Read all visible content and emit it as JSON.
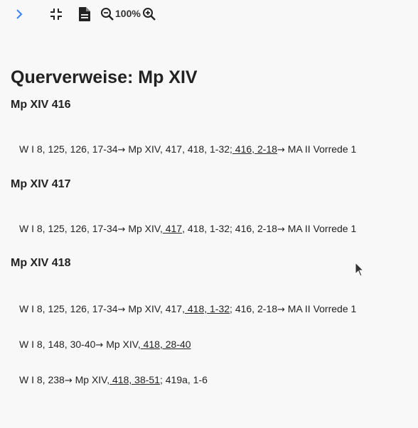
{
  "toolbar": {
    "expand_icon": "chevron-right-icon",
    "compress_icon": "compress-icon",
    "document_icon": "document-icon",
    "zoom_out_icon": "zoom-out-icon",
    "zoom_level": "100%",
    "zoom_in_icon": "zoom-in-icon"
  },
  "colors": {
    "accent": "#3b82f6",
    "text": "#222222",
    "background": "#f8f8f8"
  },
  "page": {
    "title": "Querverweise: Mp XIV"
  },
  "sections": [
    {
      "title": "Mp XIV 416",
      "lines": [
        {
          "a": "W I 8, 125, 126, 17-34",
          "b": " Mp XIV, 417, 418, 1-32;",
          "c": " 416, 2-18",
          "d": " MA II Vorrede 1"
        }
      ]
    },
    {
      "title": "Mp XIV 417",
      "lines": [
        {
          "a": "W I 8, 125, 126, 17-34",
          "b": " Mp XIV,",
          "c": " 417",
          "d": ", 418, 1-32; 416, 2-18",
          "e": " MA II Vorrede 1"
        }
      ]
    },
    {
      "title": "Mp XIV 418",
      "lines": [
        {
          "a": "W I 8, 125, 126, 17-34",
          "b": " Mp XIV, 417,",
          "c": " 418, 1-32",
          "d": "; 416, 2-18",
          "e": " MA II Vorrede 1"
        },
        {
          "a": "W I 8, 148, 30-40",
          "b": " Mp XIV,",
          "c": " 418, 28-40"
        },
        {
          "a": "W I 8, 238",
          "b": " Mp XIV,",
          "c": " 418, 38-51",
          "d": "; 419a, 1-6"
        }
      ]
    }
  ]
}
